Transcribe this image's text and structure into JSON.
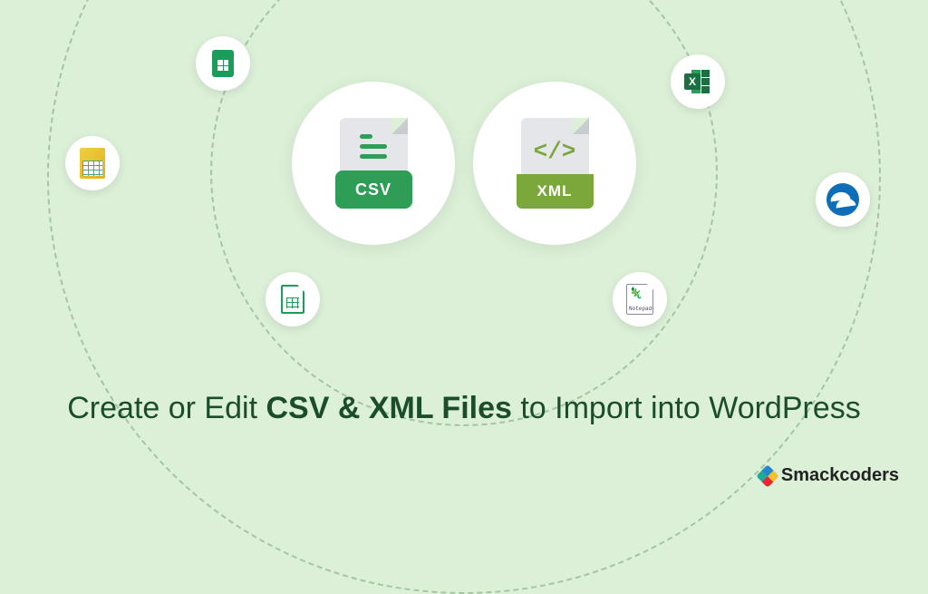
{
  "headline": {
    "prefix": "Create or Edit ",
    "bold": "CSV & XML Files",
    "suffix": " to Import into WordPress"
  },
  "center": {
    "csv_label": "CSV",
    "xml_label": "XML",
    "xml_code_glyph": "</>"
  },
  "satellites": {
    "sheets": "google-sheets",
    "libre": "libreoffice-calc",
    "excel": "microsoft-excel",
    "notepad": "notepad-plus-plus",
    "calc": "openoffice-calc",
    "oo": "openoffice"
  },
  "excel_x": "X",
  "notepad_text": "Notepad++",
  "brand": {
    "name": "Smackcoders"
  },
  "colors": {
    "background": "#dcf0d8",
    "text": "#1b4d2a",
    "csv_green": "#2e9d55",
    "xml_green": "#7aa83a"
  }
}
